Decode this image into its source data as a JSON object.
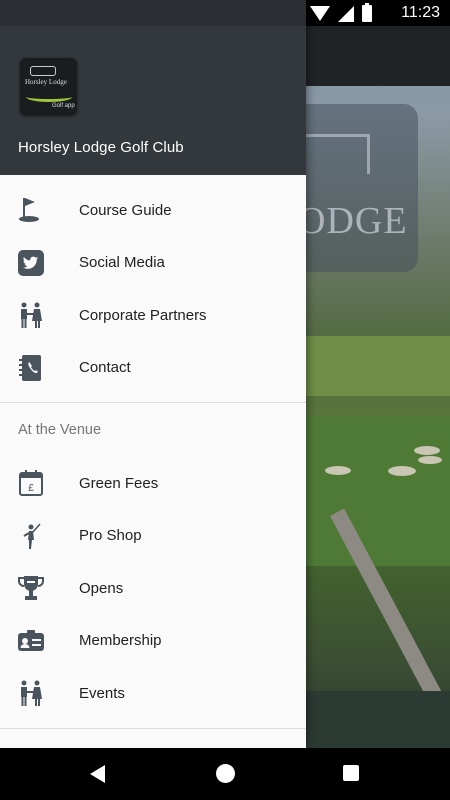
{
  "status_bar": {
    "time": "11:23"
  },
  "drawer": {
    "club_name": "Horsley Lodge Golf Club",
    "logo_text": "Horsley Lodge",
    "logo_subtext": "Golf app",
    "main_items": [
      {
        "label": "Course Guide",
        "icon": "golf-flag-icon"
      },
      {
        "label": "Social Media",
        "icon": "twitter-icon"
      },
      {
        "label": "Corporate Partners",
        "icon": "partners-icon"
      },
      {
        "label": "Contact",
        "icon": "contact-book-icon"
      }
    ],
    "section_title": "At the Venue",
    "venue_items": [
      {
        "label": "Green Fees",
        "icon": "calendar-pound-icon"
      },
      {
        "label": "Pro Shop",
        "icon": "golfer-icon"
      },
      {
        "label": "Opens",
        "icon": "trophy-icon"
      },
      {
        "label": "Membership",
        "icon": "id-card-icon"
      },
      {
        "label": "Events",
        "icon": "people-icon"
      }
    ]
  },
  "background": {
    "logo_word": "ODGE"
  },
  "colors": {
    "icon": "#4a545c",
    "header": "#33383c",
    "accent": "#9dc63b"
  }
}
